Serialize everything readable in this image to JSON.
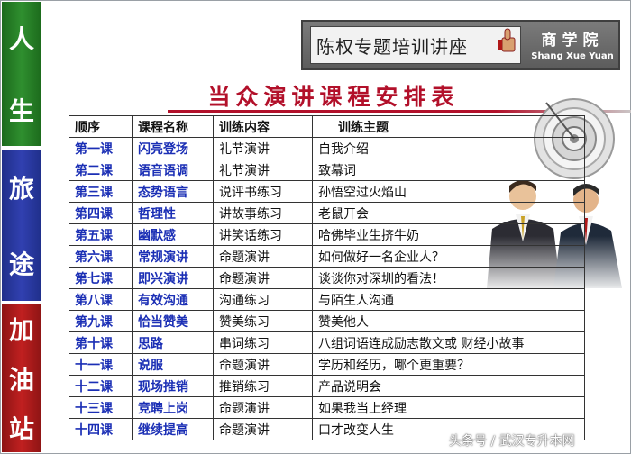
{
  "sidebar": {
    "groups": [
      {
        "chars": [
          "人",
          "生"
        ],
        "color": "#2f8f2f"
      },
      {
        "chars": [
          "旅",
          "途"
        ],
        "color": "#3140b0"
      },
      {
        "chars": [
          "加",
          "油",
          "站"
        ],
        "color": "#c02020"
      }
    ]
  },
  "header": {
    "series_title": "陈权专题培训讲座",
    "brand_cn": "商学院",
    "brand_en": "Shang Xue Yuan",
    "badge_text": "如真棒"
  },
  "title": "当众演讲课程安排表",
  "table": {
    "headers": [
      "顺序",
      "课程名称",
      "训练内容",
      "训练主题"
    ],
    "rows": [
      [
        "第一课",
        "闪亮登场",
        "礼节演讲",
        "自我介绍"
      ],
      [
        "第二课",
        "语音语调",
        "礼节演讲",
        "致幕词"
      ],
      [
        "第三课",
        "态势语言",
        "说评书练习",
        "孙悟空过火焰山"
      ],
      [
        "第四课",
        "哲理性",
        "讲故事练习",
        "老鼠开会"
      ],
      [
        "第五课",
        "幽默感",
        "讲笑话练习",
        "哈佛毕业生挤牛奶"
      ],
      [
        "第六课",
        "常规演讲",
        "命题演讲",
        "如何做好一名企业人？"
      ],
      [
        "第七课",
        "即兴演讲",
        "命题演讲",
        "谈谈你对深圳的看法！"
      ],
      [
        "第八课",
        "有效沟通",
        "沟通练习",
        "与陌生人沟通"
      ],
      [
        "第九课",
        "恰当赞美",
        "赞美练习",
        "赞美他人"
      ],
      [
        "第十课",
        "思路",
        "串词练习",
        "八组词语连成励志散文或 财经小故事"
      ],
      [
        "十一课",
        "说服",
        "命题演讲",
        "学历和经历，哪个更重要？"
      ],
      [
        "十二课",
        "现场推销",
        "推销练习",
        "产品说明会"
      ],
      [
        "十三课",
        "竞聘上岗",
        "命题演讲",
        "如果我当上经理"
      ],
      [
        "十四课",
        "继续提高",
        "命题演讲",
        "口才改变人生"
      ]
    ]
  },
  "watermark": "头条号 / 武汉专升本网"
}
